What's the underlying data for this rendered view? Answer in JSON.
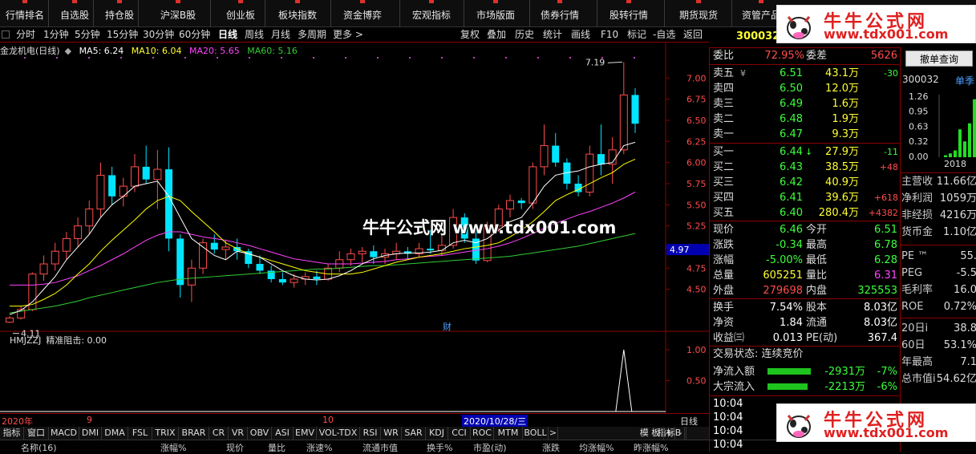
{
  "topnav": {
    "items": [
      "行情排名",
      "自选股",
      "持仓股",
      "沪深B股",
      "创业板",
      "板块指数",
      "资金博弈",
      "宏观指标",
      "市场版面",
      "债券行情",
      "股转行情",
      "期货现货",
      "资管产品"
    ]
  },
  "periodbar": {
    "periods": [
      "分时",
      "1分钟",
      "5分钟",
      "15分钟",
      "30分钟",
      "60分钟",
      "日线",
      "周线",
      "月线",
      "多周期",
      "更多 >"
    ],
    "active": "日线",
    "tools": [
      "复权",
      "叠加",
      "历史",
      "统计",
      "画线",
      "F10",
      "标记",
      "-自选",
      "返回"
    ]
  },
  "legend": {
    "stock": "金龙机电(日线)",
    "ma5": "MA5: 6.24",
    "ma10": "MA10: 6.04",
    "ma20": "MA20: 5.65",
    "ma60": "MA60: 5.16"
  },
  "chart_data": {
    "type": "candlestick",
    "title": "金龙机电(日线)",
    "yaxis_ticks": [
      "7.00",
      "6.75",
      "6.50",
      "6.25",
      "6.00",
      "5.75",
      "5.50",
      "5.25",
      "5.00",
      "4.75",
      "4.50"
    ],
    "current_price_label": "4.97",
    "high_annotation": "7.19",
    "low_annotation": "4.11",
    "x_labels": [
      "2020年",
      "9",
      "10",
      "2020/10/28/三",
      "日线"
    ],
    "finance_marker": "财",
    "candles_ohlc": [
      [
        4.11,
        4.18,
        4.1,
        4.16
      ],
      [
        4.16,
        4.3,
        4.14,
        4.26
      ],
      [
        4.26,
        4.7,
        4.24,
        4.68
      ],
      [
        4.68,
        4.9,
        4.6,
        4.8
      ],
      [
        4.8,
        5.05,
        4.72,
        4.95
      ],
      [
        4.95,
        5.18,
        4.85,
        5.1
      ],
      [
        5.1,
        5.35,
        5.0,
        5.25
      ],
      [
        5.25,
        5.55,
        5.15,
        5.45
      ],
      [
        5.45,
        6.0,
        5.35,
        5.85
      ],
      [
        5.85,
        5.95,
        5.5,
        5.6
      ],
      [
        5.6,
        5.82,
        5.48,
        5.72
      ],
      [
        5.72,
        6.1,
        5.65,
        5.95
      ],
      [
        5.95,
        6.2,
        5.75,
        5.8
      ],
      [
        5.8,
        6.15,
        5.45,
        5.92
      ],
      [
        5.92,
        6.18,
        4.95,
        5.1
      ],
      [
        5.1,
        5.15,
        4.4,
        4.55
      ],
      [
        4.55,
        4.85,
        4.35,
        4.75
      ],
      [
        4.75,
        5.1,
        4.68,
        5.05
      ],
      [
        5.05,
        5.15,
        4.92,
        4.97
      ],
      [
        4.97,
        5.08,
        4.85,
        5.0
      ],
      [
        5.0,
        5.1,
        4.85,
        4.95
      ],
      [
        4.95,
        4.98,
        4.75,
        4.8
      ],
      [
        4.8,
        4.9,
        4.68,
        4.72
      ],
      [
        4.72,
        4.78,
        4.58,
        4.62
      ],
      [
        4.62,
        4.7,
        4.55,
        4.58
      ],
      [
        4.58,
        4.68,
        4.52,
        4.62
      ],
      [
        4.62,
        4.7,
        4.55,
        4.65
      ],
      [
        4.65,
        4.72,
        4.55,
        4.62
      ],
      [
        4.62,
        4.8,
        4.6,
        4.75
      ],
      [
        4.75,
        4.95,
        4.7,
        4.85
      ],
      [
        4.85,
        4.98,
        4.78,
        4.92
      ],
      [
        4.92,
        5.0,
        4.82,
        4.95
      ],
      [
        4.95,
        5.02,
        4.8,
        4.88
      ],
      [
        4.88,
        4.98,
        4.8,
        4.92
      ],
      [
        4.92,
        5.05,
        4.85,
        4.95
      ],
      [
        4.95,
        5.0,
        4.85,
        4.92
      ],
      [
        4.92,
        5.05,
        4.88,
        4.98
      ],
      [
        4.98,
        5.2,
        4.92,
        4.96
      ],
      [
        4.96,
        5.15,
        4.9,
        5.02
      ],
      [
        5.02,
        5.45,
        4.98,
        5.35
      ],
      [
        5.35,
        5.4,
        5.05,
        5.1
      ],
      [
        5.1,
        5.25,
        4.8,
        4.84
      ],
      [
        4.84,
        5.3,
        4.82,
        5.25
      ],
      [
        5.25,
        5.5,
        5.18,
        5.45
      ],
      [
        5.45,
        5.62,
        5.35,
        5.55
      ],
      [
        5.55,
        5.58,
        5.45,
        5.52
      ],
      [
        5.52,
        6.0,
        5.45,
        5.95
      ],
      [
        5.95,
        6.45,
        5.85,
        6.2
      ],
      [
        6.2,
        6.35,
        5.95,
        6.0
      ],
      [
        6.0,
        6.05,
        5.68,
        5.75
      ],
      [
        5.75,
        5.85,
        5.6,
        5.65
      ],
      [
        5.65,
        6.2,
        5.6,
        6.1
      ],
      [
        6.1,
        6.45,
        5.85,
        5.98
      ],
      [
        5.98,
        6.3,
        5.75,
        6.15
      ],
      [
        6.15,
        7.19,
        6.1,
        6.8
      ],
      [
        6.8,
        6.88,
        6.35,
        6.46
      ]
    ],
    "ma5": [
      4.2,
      4.25,
      4.35,
      4.5,
      4.65,
      4.85,
      5.0,
      5.15,
      5.35,
      5.5,
      5.6,
      5.72,
      5.75,
      5.78,
      5.6,
      5.35,
      5.1,
      5.0,
      4.9,
      4.85,
      4.95,
      4.92,
      4.88,
      4.8,
      4.72,
      4.66,
      4.62,
      4.61,
      4.62,
      4.66,
      4.72,
      4.8,
      4.86,
      4.9,
      4.92,
      4.93,
      4.93,
      4.94,
      4.96,
      5.05,
      5.08,
      5.05,
      5.1,
      5.2,
      5.3,
      5.35,
      5.52,
      5.72,
      5.85,
      5.88,
      5.9,
      5.95,
      5.98,
      6.0,
      6.2,
      6.24
    ],
    "ma10": [
      4.3,
      4.3,
      4.32,
      4.38,
      4.45,
      4.55,
      4.68,
      4.8,
      4.95,
      5.08,
      5.2,
      5.32,
      5.45,
      5.55,
      5.6,
      5.55,
      5.42,
      5.3,
      5.18,
      5.05,
      4.98,
      4.92,
      4.88,
      4.84,
      4.8,
      4.76,
      4.72,
      4.7,
      4.68,
      4.68,
      4.68,
      4.7,
      4.74,
      4.78,
      4.82,
      4.85,
      4.88,
      4.9,
      4.92,
      4.95,
      4.98,
      5.0,
      5.02,
      5.05,
      5.12,
      5.2,
      5.3,
      5.42,
      5.55,
      5.62,
      5.68,
      5.75,
      5.82,
      5.88,
      5.98,
      6.04
    ],
    "ma20": [
      4.55,
      4.55,
      4.55,
      4.56,
      4.58,
      4.62,
      4.66,
      4.72,
      4.78,
      4.85,
      4.92,
      5.0,
      5.08,
      5.14,
      5.18,
      5.18,
      5.15,
      5.12,
      5.1,
      5.08,
      5.05,
      5.02,
      4.98,
      4.94,
      4.9,
      4.86,
      4.84,
      4.82,
      4.8,
      4.8,
      4.8,
      4.81,
      4.82,
      4.83,
      4.85,
      4.86,
      4.88,
      4.89,
      4.9,
      4.92,
      4.94,
      4.96,
      4.98,
      5.01,
      5.05,
      5.1,
      5.16,
      5.22,
      5.28,
      5.33,
      5.38,
      5.42,
      5.47,
      5.52,
      5.58,
      5.65
    ],
    "ma60": [
      4.22,
      4.24,
      4.26,
      4.28,
      4.3,
      4.33,
      4.36,
      4.4,
      4.43,
      4.46,
      4.49,
      4.52,
      4.55,
      4.58,
      4.6,
      4.62,
      4.63,
      4.64,
      4.65,
      4.66,
      4.67,
      4.68,
      4.69,
      4.7,
      4.71,
      4.72,
      4.73,
      4.74,
      4.74,
      4.75,
      4.76,
      4.77,
      4.78,
      4.78,
      4.79,
      4.8,
      4.81,
      4.82,
      4.83,
      4.84,
      4.85,
      4.86,
      4.87,
      4.88,
      4.89,
      4.91,
      4.93,
      4.95,
      4.97,
      4.99,
      5.01,
      5.04,
      5.07,
      5.1,
      5.13,
      5.16
    ],
    "ylim": [
      4.05,
      7.25
    ],
    "sub_indicator": {
      "name": "HMJZZJ",
      "label": "精准阻击: 0.00",
      "yaxis_ticks": [
        "1.00",
        "0.50"
      ],
      "spike_index": 54,
      "spike_value": 1.0
    }
  },
  "subbar": {
    "left_label": "2020年",
    "m9": "9",
    "m10": "10",
    "date_box": "2020/10/28/三",
    "right": "日线"
  },
  "tabs": [
    "指标A",
    "窗口",
    "MACD",
    "DMI",
    "DMA",
    "FSL",
    "TRIX",
    "BRAR",
    "CR",
    "VR",
    "OBV",
    "ASI",
    "EMV",
    "VOL-TDX",
    "RSI",
    "WR",
    "SAR",
    "KDJ",
    "CCI",
    "ROC",
    "MTM",
    "BOLL",
    ">",
    "指标B",
    "模 板",
    "+",
    "-"
  ],
  "colhdr": [
    "名称(16)",
    "涨幅%",
    "现价",
    "量比",
    "涨速%",
    "流通市值",
    "换手%",
    "市盈(动)",
    "涨跌",
    "均涨幅%",
    "昨涨幅%"
  ],
  "quote": {
    "code": "300032",
    "weibi_label": "委比",
    "weibi": "72.95%",
    "weicha_label": "委差",
    "weicha": "5626",
    "sell": [
      {
        "label": "卖五",
        "price": "6.51",
        "vol": "43.1万",
        "chg": "-30"
      },
      {
        "label": "卖四",
        "price": "6.50",
        "vol": "12.0万",
        "chg": ""
      },
      {
        "label": "卖三",
        "price": "6.49",
        "vol": "1.6万",
        "chg": ""
      },
      {
        "label": "卖二",
        "price": "6.48",
        "vol": "1.9万",
        "chg": ""
      },
      {
        "label": "卖一",
        "price": "6.47",
        "vol": "9.3万",
        "chg": ""
      }
    ],
    "buy": [
      {
        "label": "买一",
        "price": "6.44",
        "vol": "27.9万",
        "chg": "-11"
      },
      {
        "label": "买二",
        "price": "6.43",
        "vol": "38.5万",
        "chg": "+48"
      },
      {
        "label": "买三",
        "price": "6.42",
        "vol": "40.9万",
        "chg": ""
      },
      {
        "label": "买四",
        "price": "6.41",
        "vol": "39.6万",
        "chg": "+618"
      },
      {
        "label": "买五",
        "price": "6.40",
        "vol": "280.4万",
        "chg": "+4382"
      }
    ],
    "stats": [
      {
        "l1": "现价",
        "v1": "6.46",
        "c1": "green",
        "l2": "今开",
        "v2": "6.51",
        "c2": "green"
      },
      {
        "l1": "涨跌",
        "v1": "-0.34",
        "c1": "green",
        "l2": "最高",
        "v2": "6.78",
        "c2": "green"
      },
      {
        "l1": "涨幅",
        "v1": "-5.00%",
        "c1": "green",
        "l2": "最低",
        "v2": "6.28",
        "c2": "green"
      },
      {
        "l1": "总量",
        "v1": "605251",
        "c1": "yellow",
        "l2": "量比",
        "v2": "6.31",
        "c2": "mag"
      },
      {
        "l1": "外盘",
        "v1": "279698",
        "c1": "red",
        "l2": "内盘",
        "v2": "325553",
        "c2": "green"
      }
    ],
    "stats2": [
      {
        "l1": "换手",
        "v1": "7.54%",
        "l2": "股本",
        "v2": "8.03亿"
      },
      {
        "l1": "净资",
        "v1": "1.84",
        "l2": "流通",
        "v2": "8.03亿"
      },
      {
        "l1": "收益㈢",
        "v1": "0.013",
        "l2": "PE(动)",
        "v2": "367.4"
      }
    ],
    "trade_state": "交易状态: 连续竞价",
    "flows": [
      {
        "label": "净流入额",
        "value": "-2931万",
        "pct": "-7%"
      },
      {
        "label": "大宗流入",
        "value": "-2213万",
        "pct": "-6%"
      }
    ],
    "ticks": [
      "10:04",
      "10:04",
      "10:04",
      "10:04"
    ]
  },
  "fin": {
    "button": "撤单查询",
    "code": "300032",
    "link": "单季",
    "ticks": [
      "1.26",
      "0.95",
      "0.63",
      "0.32",
      "0.00"
    ],
    "year": "2018",
    "bars": [
      0.02,
      0.05,
      0.1,
      0.45,
      0.25,
      0.55,
      0.95
    ],
    "rows1": [
      {
        "l": "主营收",
        "v": "11.66亿"
      },
      {
        "l": "净利润",
        "v": "1059万"
      },
      {
        "l": "非经损",
        "v": "4216万"
      },
      {
        "l": "货币金",
        "v": "1.10亿"
      }
    ],
    "rows2": [
      {
        "l": "PE ™",
        "v": "55."
      },
      {
        "l": "PEG",
        "v": "-5.5"
      },
      {
        "l": "毛利率",
        "v": "16.0"
      },
      {
        "l": "ROE",
        "v": "0.72%"
      }
    ],
    "rows3": [
      {
        "l": "20日i",
        "v": "38.8"
      },
      {
        "l": "60日",
        "v": "53.1%"
      },
      {
        "l": "年最高",
        "v": "7.1"
      },
      {
        "l": "总市值i",
        "v": "54.62亿"
      }
    ]
  },
  "logo": {
    "line1": "牛牛公式网",
    "line2": "www.tdx001.com"
  },
  "watermark": "牛牛公式网 www.tdx001.com",
  "colors": {
    "up": "#ff4d4d",
    "down": "#00e5ff",
    "ma5": "#ffffff",
    "ma10": "#ffff00",
    "ma20": "#ff44ff",
    "ma60": "#33cc33",
    "frame": "#8b0000"
  }
}
